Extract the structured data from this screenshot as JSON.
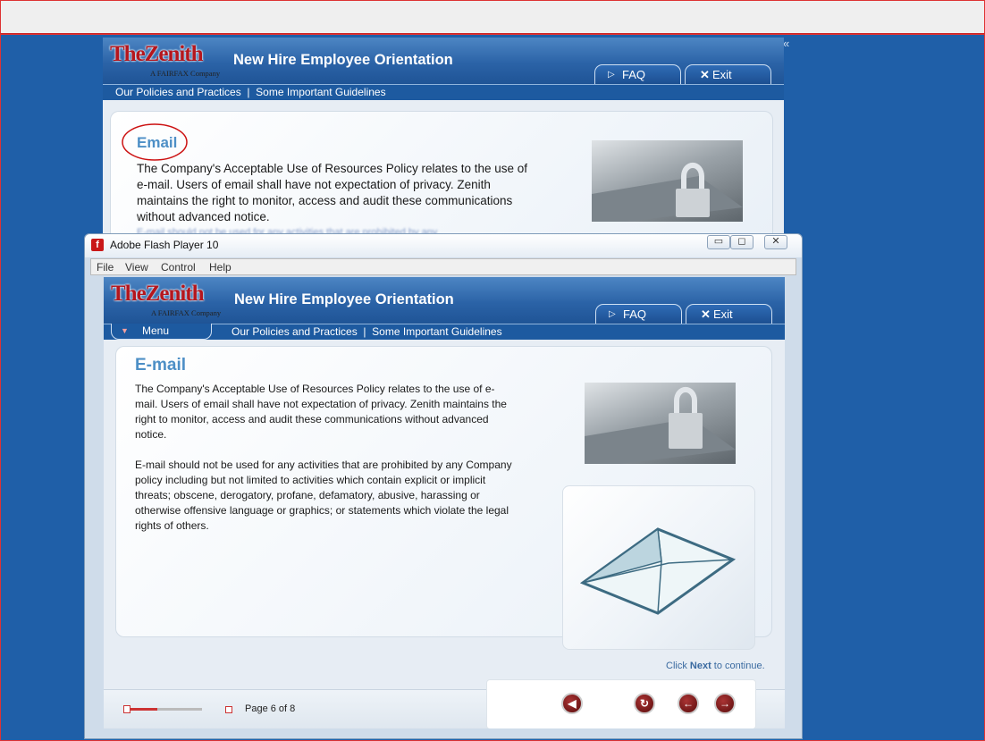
{
  "background_window": {
    "logo_main": "TheZenith",
    "logo_sub": "A FAIRFAX Company",
    "title": "New Hire Employee Orientation",
    "faq_label": "FAQ",
    "exit_label": "Exit",
    "breadcrumb": "Our Policies and Practices  |  Some Important Guidelines",
    "heading": "Email",
    "paragraph": "The Company's Acceptable Use of Resources Policy relates to the use of e-mail. Users of email shall have not expectation of privacy. Zenith maintains the right to monitor, access and audit these communications without advanced notice.",
    "obscured_line": "E-mail should not be used for any activities that are prohibited by any"
  },
  "flash_window": {
    "title": "Adobe Flash Player 10",
    "menu": [
      "File",
      "View",
      "Control",
      "Help"
    ],
    "controls": {
      "minimize": "▭",
      "maximize": "◻",
      "close": "✕"
    }
  },
  "course": {
    "logo_main": "TheZenith",
    "logo_sub": "A FAIRFAX Company",
    "title": "New Hire Employee Orientation",
    "faq_label": "FAQ",
    "exit_label": "Exit",
    "menu_label": "Menu",
    "breadcrumb": "Our Policies and Practices  |  Some Important Guidelines",
    "heading": "E-mail",
    "paragraph1": "The Company's Acceptable Use of Resources Policy relates to the use of e-mail. Users of email shall have not expectation of privacy. Zenith maintains the right to monitor, access and audit these communications without advanced notice.",
    "paragraph2": "E-mail should not be used for any activities that are prohibited by any Company policy including but not limited to activities which contain explicit or implicit threats; obscene, derogatory, profane, defamatory, abusive, harassing or otherwise offensive language or graphics; or statements which violate the legal rights of others.",
    "continue_prefix": "Click ",
    "continue_bold": "Next",
    "continue_suffix": " to continue.",
    "page_indicator": "Page 6 of 8"
  },
  "colors": {
    "brand_red": "#b4161d",
    "header_blue": "#2b63a7",
    "heading_blue": "#4d8fc6",
    "desktop_blue": "#1f5fa8"
  }
}
